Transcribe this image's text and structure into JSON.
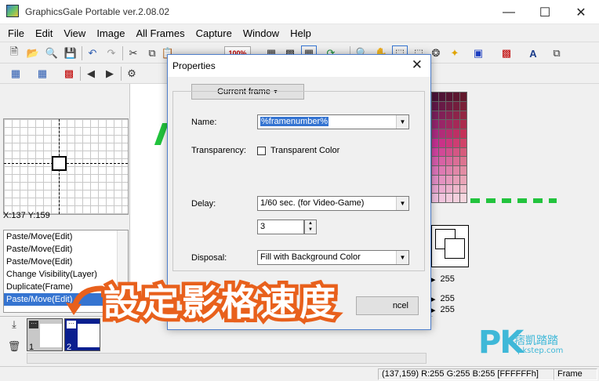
{
  "window": {
    "title": "GraphicsGale Portable ver.2.08.02"
  },
  "menu": [
    "File",
    "Edit",
    "View",
    "Image",
    "All Frames",
    "Capture",
    "Window",
    "Help"
  ],
  "toolbar": {
    "zoom": "100%"
  },
  "preview": {
    "coords": "X:137 Y:159"
  },
  "history": [
    "Paste/Move(Edit)",
    "Paste/Move(Edit)",
    "Paste/Move(Edit)",
    "Change Visibility(Layer)",
    "Duplicate(Frame)",
    "Paste/Move(Edit)"
  ],
  "history_selected_index": 5,
  "frames": [
    {
      "number": "1",
      "selected": false
    },
    {
      "number": "2",
      "selected": true
    }
  ],
  "palette_panel": {
    "values": [
      "255",
      "255",
      "255"
    ]
  },
  "statusbar": {
    "position": "(137,159)",
    "color": "R:255 G:255 B:255",
    "hex": "[FFFFFFh]",
    "mode": "Frame"
  },
  "dialog": {
    "title": "Properties",
    "frame_button": "Current frame",
    "name_label": "Name:",
    "name_value": "%framenumber%",
    "transparency_label": "Transparency:",
    "transparent_color_label": "Transparent Color",
    "delay_label": "Delay:",
    "delay_value": "1/60 sec. (for Video-Game)",
    "delay_count": "3",
    "disposal_label": "Disposal:",
    "disposal_value": "Fill with Background Color",
    "cancel_partial": "ncel"
  },
  "overlay": {
    "caption": "設定影格速度"
  },
  "watermark": {
    "brand": "PK",
    "chinese": "痞凱踏踏",
    "site": "pkstep.com"
  },
  "colors": {
    "accent": "#3574d1",
    "caption_stroke": "#e8601c",
    "green": "#22c33d",
    "watermark": "#3fb8d8"
  }
}
